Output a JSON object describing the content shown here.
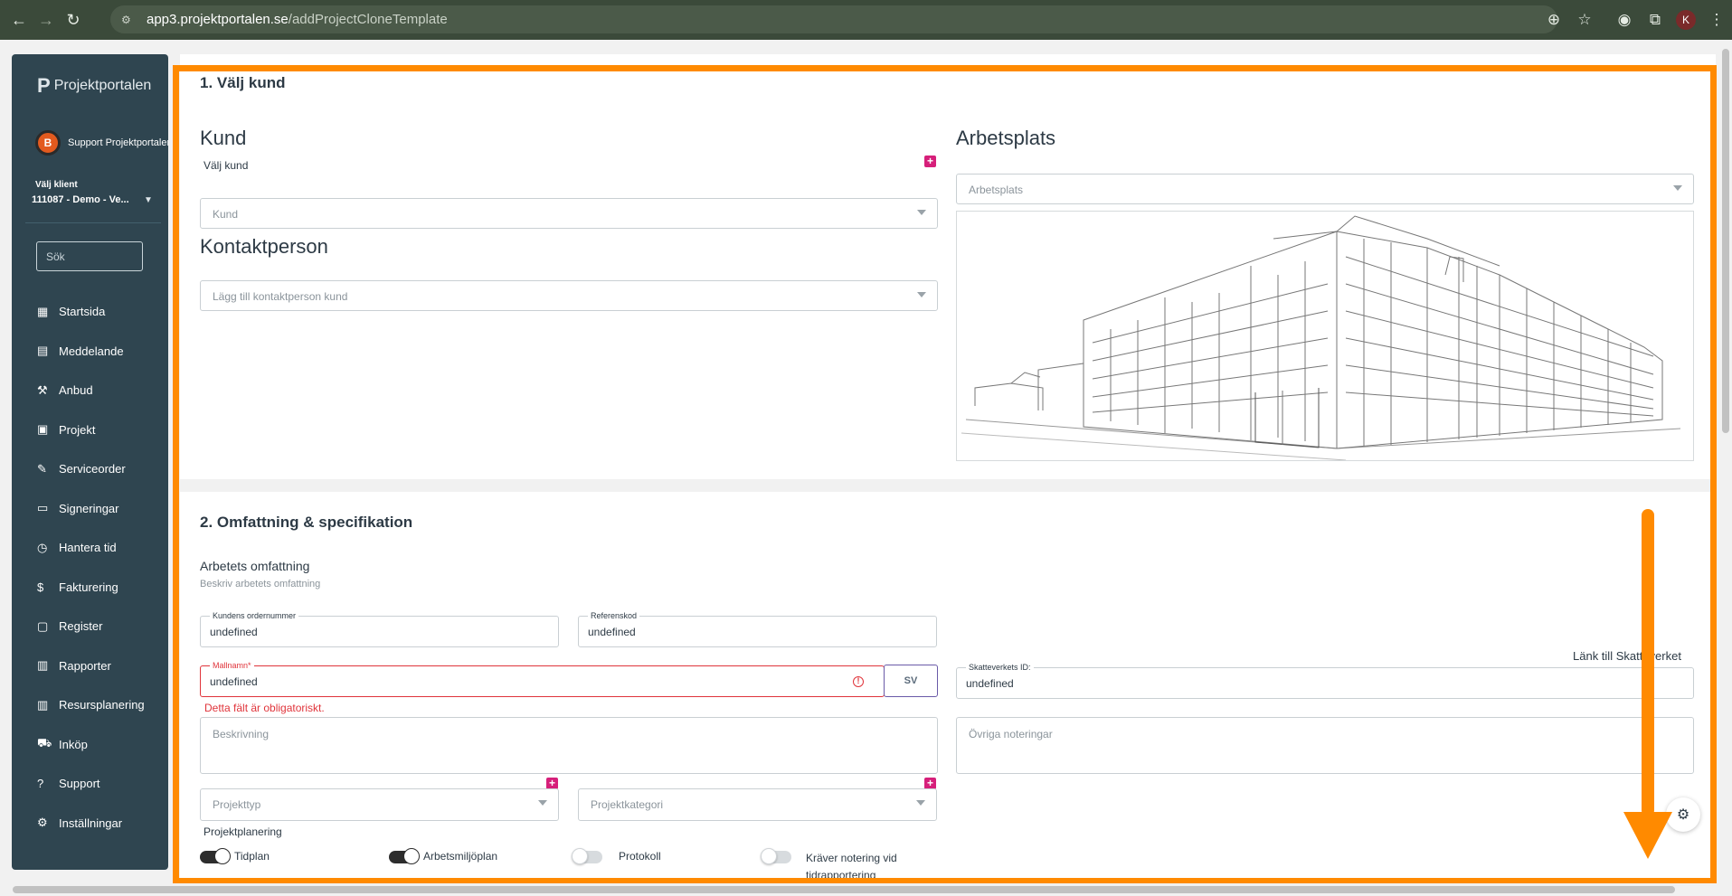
{
  "browser": {
    "url_host": "app3.projektportalen.se",
    "url_path": "/addProjectCloneTemplate",
    "profile_initial": "K"
  },
  "sidebar": {
    "logo": "Projektportalen",
    "user_name": "Support Projektportalen",
    "user_avatar": "B",
    "client_label": "Välj klient",
    "client_value": "111087 - Demo - Ve...",
    "search_placeholder": "Sök",
    "items": [
      {
        "label": "Startsida",
        "icon": "dashboard-icon",
        "glyph": "▦"
      },
      {
        "label": "Meddelande",
        "icon": "message-icon",
        "glyph": "▤"
      },
      {
        "label": "Anbud",
        "icon": "gavel-icon",
        "glyph": "⚒"
      },
      {
        "label": "Projekt",
        "icon": "project-icon",
        "glyph": "▣"
      },
      {
        "label": "Serviceorder",
        "icon": "wrench-icon",
        "glyph": "✎"
      },
      {
        "label": "Signeringar",
        "icon": "signature-icon",
        "glyph": "▭"
      },
      {
        "label": "Hantera tid",
        "icon": "clock-icon",
        "glyph": "◷"
      },
      {
        "label": "Fakturering",
        "icon": "dollar-icon",
        "glyph": "$"
      },
      {
        "label": "Register",
        "icon": "register-icon",
        "glyph": "▢"
      },
      {
        "label": "Rapporter",
        "icon": "calendar-icon",
        "glyph": "▥"
      },
      {
        "label": "Resursplanering",
        "icon": "calendar-icon",
        "glyph": "▥"
      },
      {
        "label": "Inköp",
        "icon": "cart-icon",
        "glyph": "⛟"
      },
      {
        "label": "Support",
        "icon": "help-icon",
        "glyph": "?"
      },
      {
        "label": "Inställningar",
        "icon": "gear-icon",
        "glyph": "⚙"
      }
    ]
  },
  "section1": {
    "title": "1. Välj kund",
    "kund_heading": "Kund",
    "valj_kund_label": "Välj kund",
    "kund_placeholder": "Kund",
    "kontakt_heading": "Kontaktperson",
    "kontakt_placeholder": "Lägg till kontaktperson kund",
    "arbetsplats_heading": "Arbetsplats",
    "arbetsplats_placeholder": "Arbetsplats"
  },
  "section2": {
    "title": "2. Omfattning & specifikation",
    "omfattning_title": "Arbetets omfattning",
    "omfattning_subtitle": "Beskriv arbetets omfattning",
    "ordernummer_label": "Kundens ordernummer",
    "ordernummer_value": "undefined",
    "referenskod_label": "Referenskod",
    "referenskod_value": "undefined",
    "mallnamn_label": "Mallnamn*",
    "mallnamn_value": "undefined",
    "lang_button": "SV",
    "error_text": "Detta fält är obligatoriskt.",
    "skatteverket_link": "Länk till Skatteverket",
    "skatteverket_label": "Skatteverkets ID:",
    "skatteverket_value": "undefined",
    "beskrivning_placeholder": "Beskrivning",
    "ovriga_placeholder": "Övriga noteringar",
    "projekttyp_placeholder": "Projekttyp",
    "projektkategori_placeholder": "Projektkategori",
    "planering_label": "Projektplanering",
    "toggles": [
      {
        "label": "Tidplan",
        "on": true
      },
      {
        "label": "Arbetsmiljöplan",
        "on": true
      },
      {
        "label": "Protokoll",
        "on": false
      },
      {
        "label": "Kräver notering vid tidrapportering",
        "on": false
      }
    ]
  },
  "colors": {
    "accent": "#d61f7a",
    "sidebar": "#2f4550",
    "error": "#e0343b",
    "highlight": "#ff8a00"
  }
}
